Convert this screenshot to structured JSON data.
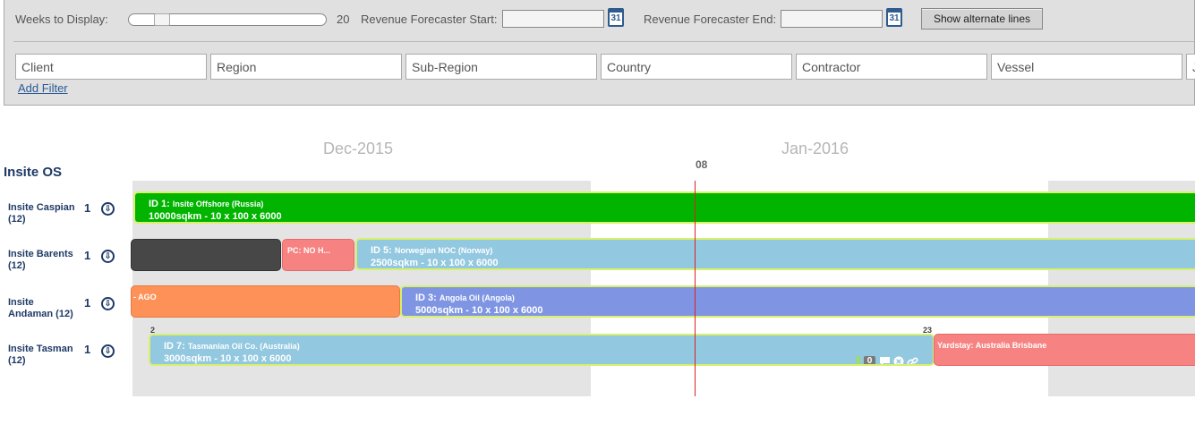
{
  "toolbar": {
    "weeks_label": "Weeks to Display:",
    "weeks_value": "20",
    "start_label": "Revenue Forecaster Start:",
    "end_label": "Revenue Forecaster End:",
    "calendar_glyph": "31",
    "alt_lines_label": "Show alternate lines"
  },
  "filters": {
    "items": [
      "Client",
      "Region",
      "Sub-Region",
      "Country",
      "Contractor",
      "Vessel",
      "J"
    ],
    "add_label": "Add Filter"
  },
  "timeline": {
    "months": [
      "Dec-2015",
      "Jan-2016"
    ],
    "today_week": "08",
    "group_title": "Insite OS",
    "download_glyph": "⇩",
    "rows": [
      {
        "name": "Insite Caspian",
        "sub": "(12)",
        "count": "1"
      },
      {
        "name": "Insite Barents",
        "sub": "(12)",
        "count": "1"
      },
      {
        "name": "Insite",
        "sub": "Andaman (12)",
        "count": "1"
      },
      {
        "name": "Insite Tasman",
        "sub": "(12)",
        "count": "1"
      }
    ],
    "bars": {
      "caspian_main": {
        "title": "ID 1:",
        "client": "Insite Offshore (Russia)",
        "detail": "10000sqkm - 10 x 100 x 6000"
      },
      "barents_pc": {
        "title": "PC: NO H..."
      },
      "barents_main": {
        "title": "ID 5:",
        "client": "Norwegian NOC (Norway)",
        "detail": "2500sqkm - 10 x 100 x 6000"
      },
      "andaman_prev": {
        "title": "- AGO"
      },
      "andaman_main": {
        "title": "ID 3:",
        "client": "Angola Oil (Angola)",
        "detail": "5000sqkm - 10 x 100 x 6000"
      },
      "tasman_main": {
        "title": "ID 7:",
        "client": "Tasmanian Oil Co. (Australia)",
        "detail": "3000sqkm - 10 x 100 x 6000",
        "start_marker": "2",
        "end_marker": "23",
        "dollar": "$",
        "badge": "0"
      },
      "tasman_yard": {
        "title": "Yardstay: Australia Brisbane"
      }
    }
  },
  "colors": {
    "green": "#00b400",
    "blue": "#92c8e0",
    "periwinkle": "#7f95e4",
    "pink": "#f68282",
    "orange": "#fd9158",
    "dark": "#474747",
    "today_line": "#dd2222",
    "highlight_border": "#d8f06a"
  }
}
